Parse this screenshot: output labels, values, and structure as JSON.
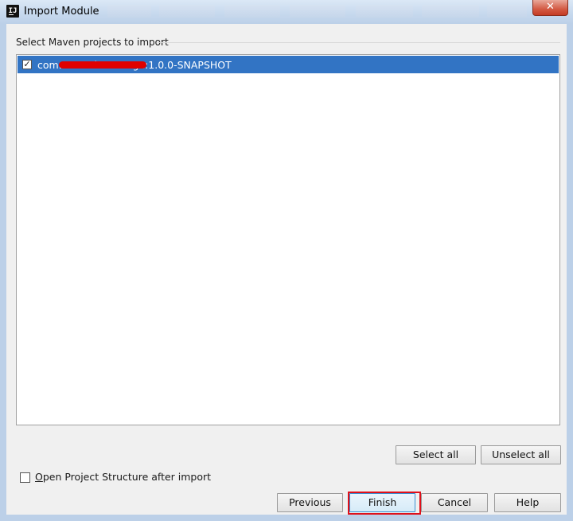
{
  "window": {
    "title": "Import Module",
    "close_glyph": "✕"
  },
  "main": {
    "section_label": "Select Maven projects to import",
    "projects": [
      {
        "label": "com.z...-web-manage:1.0.0-SNAPSHOT",
        "checked": true
      }
    ],
    "select_all_label": "Select all",
    "unselect_all_label": "Unselect all"
  },
  "options": {
    "open_structure_mnemonic": "O",
    "open_structure_rest": "pen Project Structure after import",
    "open_structure_checked": false
  },
  "footer": {
    "previous_label": "Previous",
    "finish_label": "Finish",
    "cancel_label": "Cancel",
    "help_label": "Help"
  },
  "colors": {
    "selection": "#3274c4",
    "highlight": "#e0101a",
    "redaction": "#e00000"
  },
  "icons": {
    "app": "intellij-idea-icon",
    "close": "close-icon",
    "check": "checkmark-icon"
  }
}
